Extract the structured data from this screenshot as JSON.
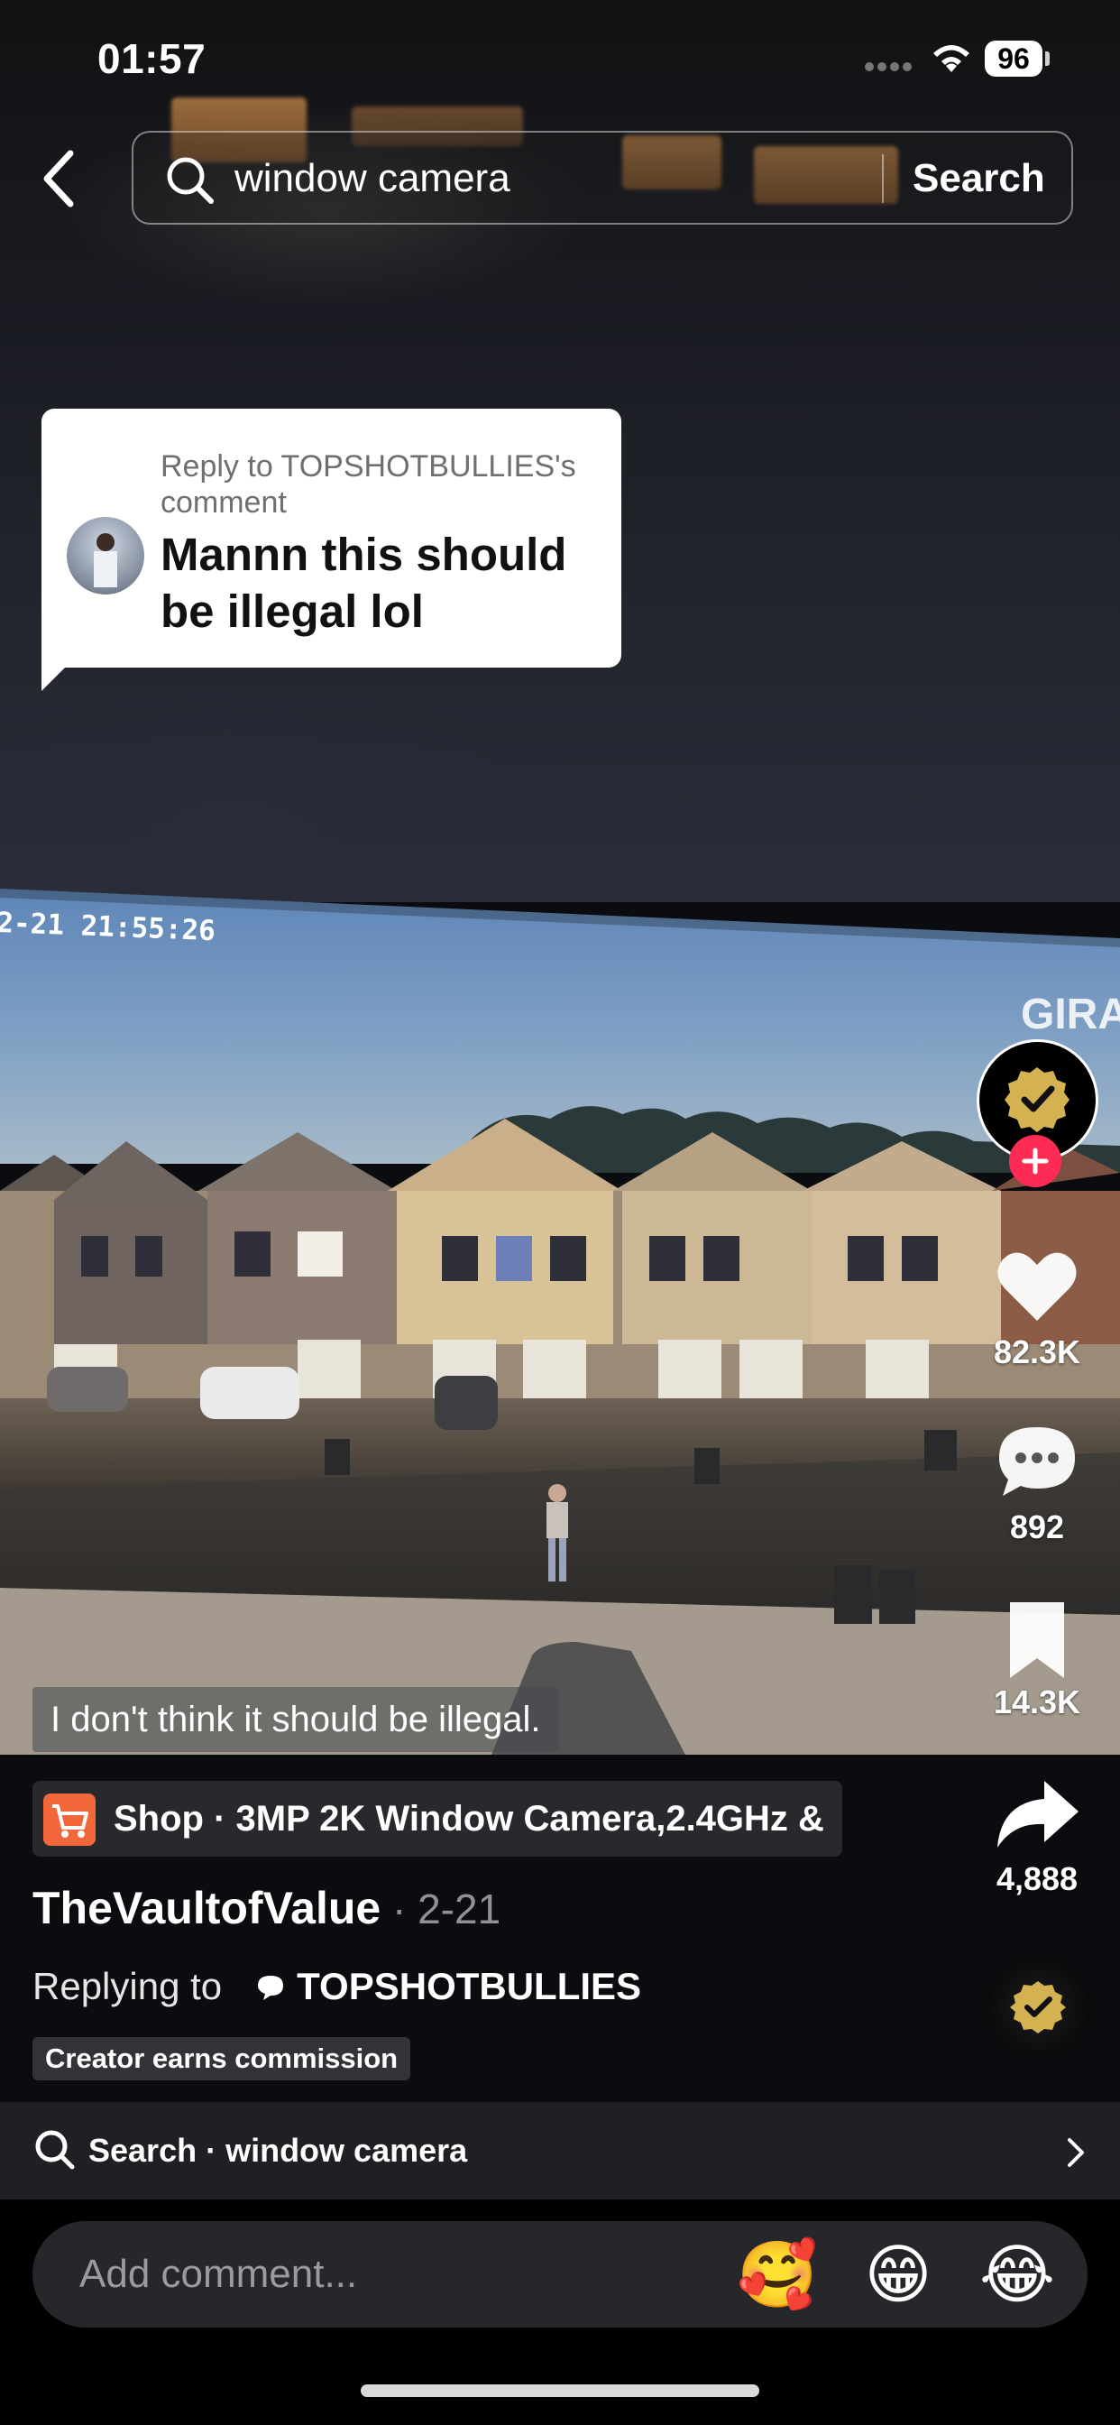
{
  "status_bar": {
    "time": "01:57",
    "battery": "96"
  },
  "search": {
    "query": "window camera",
    "submit_label": "Search"
  },
  "reply_bubble": {
    "context": "Reply to TOPSHOTBULLIES's comment",
    "text": "Mannn this should be illegal lol"
  },
  "video": {
    "timestamp": "2-21 21:55:26",
    "watermark": "GIRA",
    "caption": "I don't think it should be illegal."
  },
  "actions": {
    "likes": "82.3K",
    "comments": "892",
    "saves": "14.3K",
    "shares": "4,888"
  },
  "shop": {
    "label": "Shop · 3MP 2K Window Camera,2.4GHz &"
  },
  "post": {
    "username": "TheVaultofValue",
    "date": " · 2-21",
    "replying_label": "Replying to",
    "replying_user": "TOPSHOTBULLIES",
    "commission_badge": "Creator earns commission"
  },
  "suggestion": {
    "label": "Search · window camera"
  },
  "comment": {
    "placeholder": "Add comment...",
    "emojis": [
      "🥰",
      "😁",
      "😂"
    ]
  },
  "colors": {
    "accent": "#fe2c55",
    "shop": "#f2683a",
    "verified_gold": "#d4b251"
  }
}
